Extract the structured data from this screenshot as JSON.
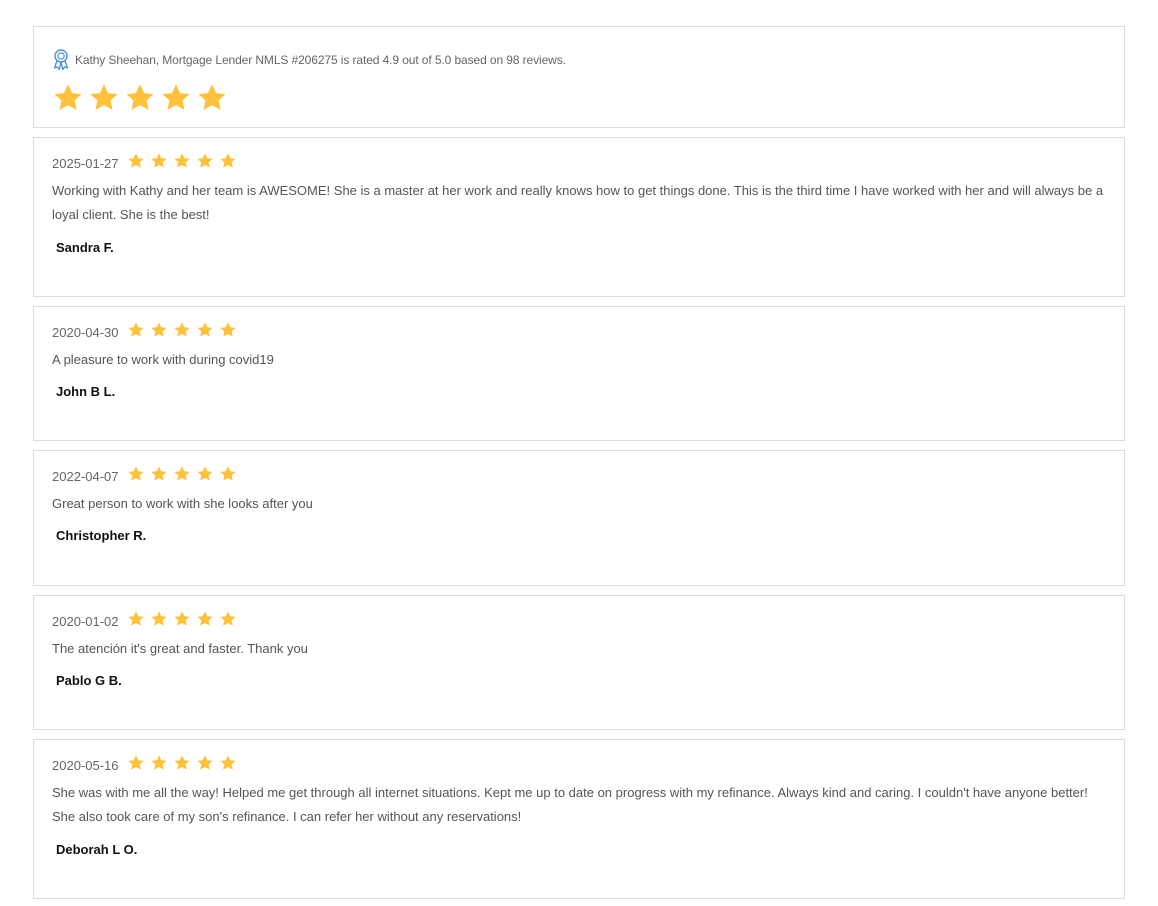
{
  "summary": {
    "text": "Kathy Sheehan, Mortgage Lender NMLS #206275 is rated 4.9 out of 5.0 based on 98 reviews.",
    "rating": 4.9,
    "rating_max": 5.0,
    "review_count": 98,
    "stars_shown": 5,
    "icon": "award-ribbon-icon"
  },
  "colors": {
    "star": "#FFC13B",
    "award_icon": "#4A90D9",
    "border": "#DCDCDC"
  },
  "reviews": [
    {
      "date": "2025-01-27",
      "stars": 5,
      "text": "Working with Kathy and her team is AWESOME! She is a master at her work and really knows how to get things done. This is the third time I have worked with her and will always be a loyal client. She is the best!",
      "author": "Sandra F."
    },
    {
      "date": "2020-04-30",
      "stars": 5,
      "text": "A pleasure to work with during covid19",
      "author": "John B L."
    },
    {
      "date": "2022-04-07",
      "stars": 5,
      "text": "Great person to work with she looks after you",
      "author": "Christopher R."
    },
    {
      "date": "2020-01-02",
      "stars": 5,
      "text": "The atención it's great and faster. Thank you",
      "author": "Pablo G B."
    },
    {
      "date": "2020-05-16",
      "stars": 5,
      "text": "She was with me all the way! Helped me get through all internet situations. Kept me up to date on progress with my refinance. Always kind and caring. I couldn't have anyone better! She also took care of my son's refinance. I can refer her without any reservations!",
      "author": "Deborah L O."
    }
  ]
}
